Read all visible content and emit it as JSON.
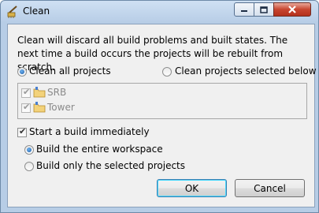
{
  "window": {
    "title": "Clean",
    "controls": {
      "minimize": "minimize-icon",
      "maximize": "maximize-icon",
      "close": "close-icon"
    }
  },
  "dialog": {
    "description": "Clean will discard all build problems and built states.  The next time a build occurs the projects will be rebuilt from scratch.",
    "scope_options": [
      {
        "label": "Clean all projects",
        "selected": true
      },
      {
        "label": "Clean projects selected below",
        "selected": false
      }
    ],
    "projects": [
      {
        "name": "SRB",
        "checked": true
      },
      {
        "name": "Tower",
        "checked": true
      }
    ],
    "start_build": {
      "label": "Start a build immediately",
      "checked": true
    },
    "build_options": [
      {
        "label": "Build the entire workspace",
        "selected": true
      },
      {
        "label": "Build only the selected projects",
        "selected": false
      }
    ],
    "buttons": {
      "ok": "OK",
      "cancel": "Cancel"
    }
  },
  "colors": {
    "accent": "#3c7fb1",
    "close": "#c7452f",
    "frame": "#b7cde6"
  }
}
